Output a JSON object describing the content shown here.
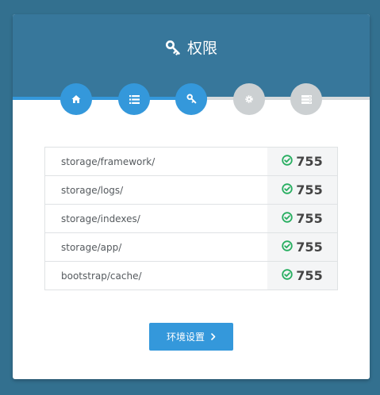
{
  "header": {
    "title": "权限",
    "title_icon": "key-icon"
  },
  "steps": [
    {
      "name": "home-icon",
      "state": "complete"
    },
    {
      "name": "list-icon",
      "state": "complete"
    },
    {
      "name": "key-icon",
      "state": "current"
    },
    {
      "name": "gear-icon",
      "state": "pending"
    },
    {
      "name": "server-icon",
      "state": "pending"
    }
  ],
  "permissions": [
    {
      "path": "storage/framework/",
      "value": "755",
      "status": "ok"
    },
    {
      "path": "storage/logs/",
      "value": "755",
      "status": "ok"
    },
    {
      "path": "storage/indexes/",
      "value": "755",
      "status": "ok"
    },
    {
      "path": "storage/app/",
      "value": "755",
      "status": "ok"
    },
    {
      "path": "bootstrap/cache/",
      "value": "755",
      "status": "ok"
    }
  ],
  "actions": {
    "next_label": "环境设置"
  },
  "colors": {
    "background": "#33708f",
    "header": "#37779b",
    "accent": "#3498db",
    "inactive": "#ccd0d2",
    "ok": "#27ae60"
  }
}
